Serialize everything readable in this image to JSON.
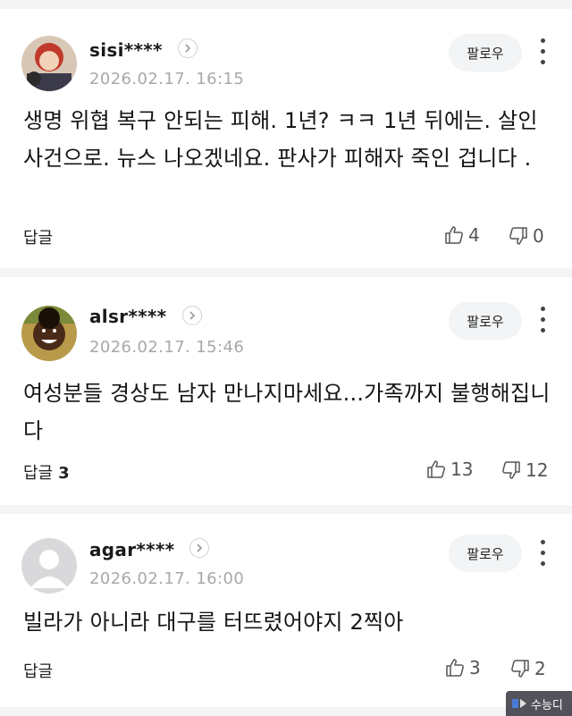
{
  "comments": [
    {
      "username": "sisi****",
      "date": "2026.02.17. 16:15",
      "follow_label": "팔로우",
      "text": "생명 위협 복구 안되는 피해. 1년? ㅋㅋ 1년 뒤에는. 살인 사건으로. 뉴스 나오겠네요. 판사가 피해자 죽인 겁니다 .",
      "reply_label": "답글",
      "reply_count": "",
      "likes": "4",
      "dislikes": "0"
    },
    {
      "username": "alsr****",
      "date": "2026.02.17. 15:46",
      "follow_label": "팔로우",
      "text": "여성분들 경상도 남자 만나지마세요...가족까지 불행해집니다",
      "reply_label": "답글",
      "reply_count": "3",
      "likes": "13",
      "dislikes": "12"
    },
    {
      "username": "agar****",
      "date": "2026.02.17. 16:00",
      "follow_label": "팔로우",
      "text": "빌라가 아니라 대구를 터뜨렸어야지 2찍아",
      "reply_label": "답글",
      "reply_count": "",
      "likes": "3",
      "dislikes": "2"
    }
  ],
  "watermark": "수능디",
  "colors": {
    "date": "#a8a8ac",
    "follow_bg": "#f2f4f5",
    "separator": "#f4f4f5"
  }
}
